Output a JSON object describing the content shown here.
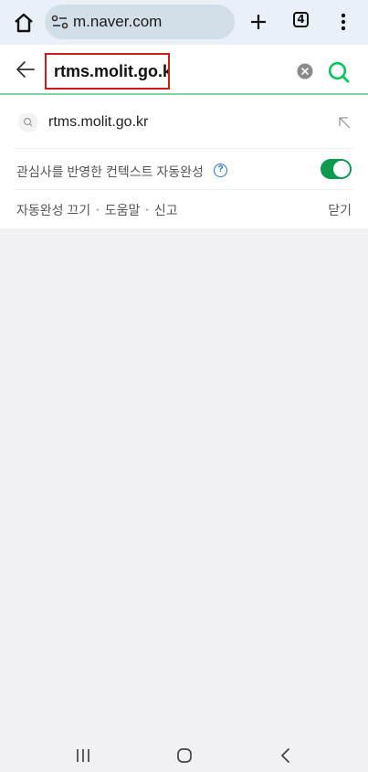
{
  "browser": {
    "url_display": "m.naver.com",
    "tab_count": "4",
    "icons": {
      "home": "home-icon",
      "site_settings": "tune-icon",
      "new_tab": "plus-icon",
      "menu": "more-vert-icon"
    }
  },
  "search": {
    "query": "rtms.molit.go.kr",
    "accent_color": "#03c75a",
    "highlight_border_color": "#d21a1a"
  },
  "suggestions": [
    {
      "text": "rtms.molit.go.kr"
    }
  ],
  "context_setting": {
    "label": "관심사를 반영한 컨텍스트 자동완성",
    "help": "?",
    "enabled": true
  },
  "footer": {
    "links": [
      "자동완성 끄기",
      "도움말",
      "신고"
    ],
    "close": "닫기"
  }
}
